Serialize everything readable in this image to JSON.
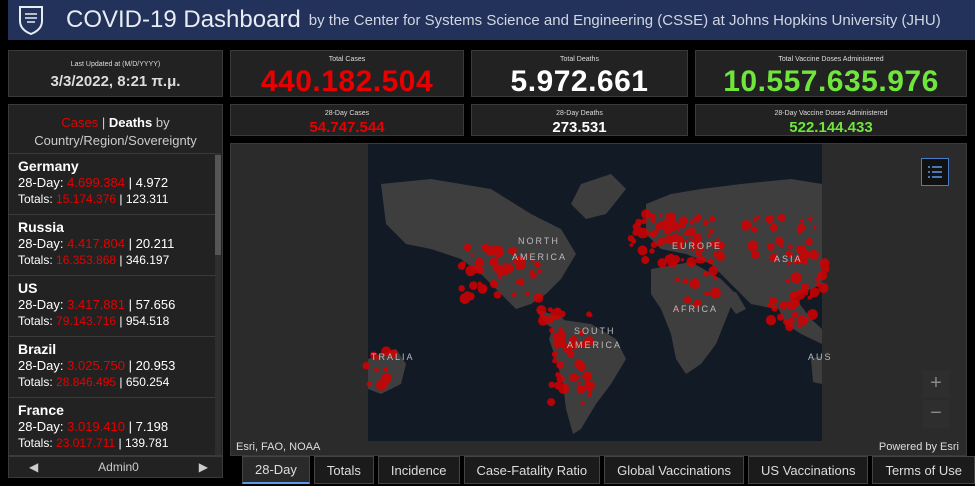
{
  "header": {
    "title": "COVID-19 Dashboard",
    "subtitle": "by the Center for Systems Science and Engineering (CSSE) at Johns Hopkins University (JHU)"
  },
  "last_updated": {
    "label": "Last Updated at (M/D/YYYY)",
    "value": "3/3/2022, 8:21 π.μ."
  },
  "totals": {
    "cases_label": "Total Cases",
    "cases_value": "440.182.504",
    "deaths_label": "Total Deaths",
    "deaths_value": "5.972.661",
    "vax_label": "Total Vaccine Doses Administered",
    "vax_value": "10.557.635.976"
  },
  "day28": {
    "cases_label": "28-Day Cases",
    "cases_value": "54.747.544",
    "deaths_label": "28-Day Deaths",
    "deaths_value": "273.531",
    "vax_label": "28-Day Vaccine Doses Administered",
    "vax_value": "522.144.433"
  },
  "list": {
    "header_cases": "Cases",
    "header_sep": " | ",
    "header_deaths": "Deaths",
    "header_by": " by",
    "header_line2": "Country/Region/Sovereignty",
    "day28_prefix": "28-Day: ",
    "totals_prefix": "Totals: ",
    "sep": " | ",
    "countries": [
      {
        "name": "Germany",
        "d28_cases": "4.699.384",
        "d28_deaths": "4.972",
        "tot_cases": "15.174.376",
        "tot_deaths": "123.311"
      },
      {
        "name": "Russia",
        "d28_cases": "4.417.804",
        "d28_deaths": "20.211",
        "tot_cases": "16.353.868",
        "tot_deaths": "346.197"
      },
      {
        "name": "US",
        "d28_cases": "3.417.881",
        "d28_deaths": "57.656",
        "tot_cases": "79.143.716",
        "tot_deaths": "954.518"
      },
      {
        "name": "Brazil",
        "d28_cases": "3.025.750",
        "d28_deaths": "20.953",
        "tot_cases": "28.846.495",
        "tot_deaths": "650.254"
      },
      {
        "name": "France",
        "d28_cases": "3.019.410",
        "d28_deaths": "7.198",
        "tot_cases": "23.017.711",
        "tot_deaths": "139.781"
      }
    ],
    "footer_label": "Admin0"
  },
  "map": {
    "labels": {
      "north_america_1": "NORTH",
      "north_america_2": "AMERICA",
      "europe": "EUROPE",
      "asia": "ASIA",
      "africa": "AFRICA",
      "south_america_1": "SOUTH",
      "south_america_2": "AMERICA",
      "australia_left": "TRALIA",
      "australia_right": "AUS"
    },
    "attribution_left": "Esri, FAO, NOAA",
    "attribution_right": "Powered by Esri",
    "zoom_in": "+",
    "zoom_out": "−"
  },
  "tabs": [
    "28-Day",
    "Totals",
    "Incidence",
    "Case-Fatality Ratio",
    "Global Vaccinations",
    "US Vaccinations",
    "Terms of Use"
  ],
  "colors": {
    "header_bg": "#22325a",
    "cases_red": "#e60000",
    "vaccine_green": "#70e63c",
    "active_tab_accent": "#5c9be6"
  }
}
